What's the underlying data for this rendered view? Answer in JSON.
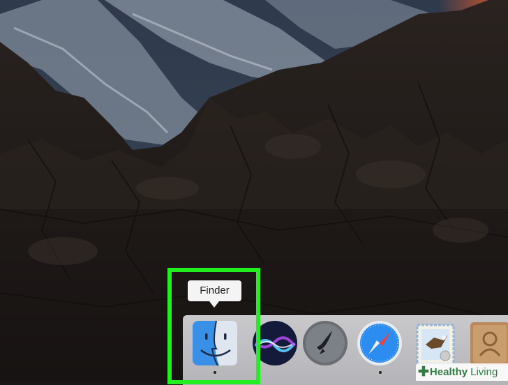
{
  "desktop": {
    "wallpaper": "mountain-rocks-wallpaper"
  },
  "dock": {
    "items": [
      {
        "name": "Finder",
        "icon": "finder-icon",
        "running": true
      },
      {
        "name": "Siri",
        "icon": "siri-icon",
        "running": false
      },
      {
        "name": "Launchpad",
        "icon": "launchpad-icon",
        "running": false
      },
      {
        "name": "Safari",
        "icon": "safari-icon",
        "running": true
      },
      {
        "name": "Mail",
        "icon": "mail-icon",
        "running": false
      },
      {
        "name": "Contacts",
        "icon": "contacts-icon",
        "running": false
      }
    ]
  },
  "tooltip": {
    "text": "Finder"
  },
  "highlight": {
    "color": "#22ee22"
  },
  "watermark": {
    "brand_bold": "Healthy",
    "brand_light": "Living",
    "color": "#2f7d43"
  }
}
